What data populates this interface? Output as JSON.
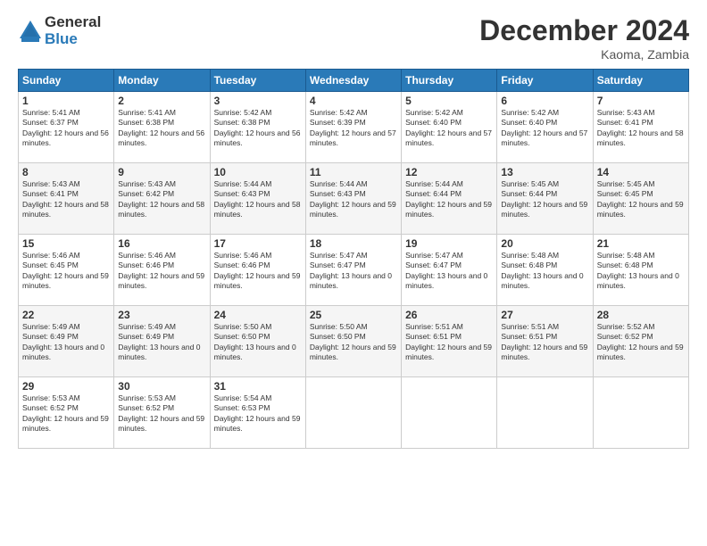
{
  "logo": {
    "general": "General",
    "blue": "Blue"
  },
  "title": "December 2024",
  "subtitle": "Kaoma, Zambia",
  "days": [
    "Sunday",
    "Monday",
    "Tuesday",
    "Wednesday",
    "Thursday",
    "Friday",
    "Saturday"
  ],
  "weeks": [
    [
      {
        "day": "1",
        "sunrise": "5:41 AM",
        "sunset": "6:37 PM",
        "daylight": "12 hours and 56 minutes."
      },
      {
        "day": "2",
        "sunrise": "5:41 AM",
        "sunset": "6:38 PM",
        "daylight": "12 hours and 56 minutes."
      },
      {
        "day": "3",
        "sunrise": "5:42 AM",
        "sunset": "6:38 PM",
        "daylight": "12 hours and 56 minutes."
      },
      {
        "day": "4",
        "sunrise": "5:42 AM",
        "sunset": "6:39 PM",
        "daylight": "12 hours and 57 minutes."
      },
      {
        "day": "5",
        "sunrise": "5:42 AM",
        "sunset": "6:40 PM",
        "daylight": "12 hours and 57 minutes."
      },
      {
        "day": "6",
        "sunrise": "5:42 AM",
        "sunset": "6:40 PM",
        "daylight": "12 hours and 57 minutes."
      },
      {
        "day": "7",
        "sunrise": "5:43 AM",
        "sunset": "6:41 PM",
        "daylight": "12 hours and 58 minutes."
      }
    ],
    [
      {
        "day": "8",
        "sunrise": "5:43 AM",
        "sunset": "6:41 PM",
        "daylight": "12 hours and 58 minutes."
      },
      {
        "day": "9",
        "sunrise": "5:43 AM",
        "sunset": "6:42 PM",
        "daylight": "12 hours and 58 minutes."
      },
      {
        "day": "10",
        "sunrise": "5:44 AM",
        "sunset": "6:43 PM",
        "daylight": "12 hours and 58 minutes."
      },
      {
        "day": "11",
        "sunrise": "5:44 AM",
        "sunset": "6:43 PM",
        "daylight": "12 hours and 59 minutes."
      },
      {
        "day": "12",
        "sunrise": "5:44 AM",
        "sunset": "6:44 PM",
        "daylight": "12 hours and 59 minutes."
      },
      {
        "day": "13",
        "sunrise": "5:45 AM",
        "sunset": "6:44 PM",
        "daylight": "12 hours and 59 minutes."
      },
      {
        "day": "14",
        "sunrise": "5:45 AM",
        "sunset": "6:45 PM",
        "daylight": "12 hours and 59 minutes."
      }
    ],
    [
      {
        "day": "15",
        "sunrise": "5:46 AM",
        "sunset": "6:45 PM",
        "daylight": "12 hours and 59 minutes."
      },
      {
        "day": "16",
        "sunrise": "5:46 AM",
        "sunset": "6:46 PM",
        "daylight": "12 hours and 59 minutes."
      },
      {
        "day": "17",
        "sunrise": "5:46 AM",
        "sunset": "6:46 PM",
        "daylight": "12 hours and 59 minutes."
      },
      {
        "day": "18",
        "sunrise": "5:47 AM",
        "sunset": "6:47 PM",
        "daylight": "13 hours and 0 minutes."
      },
      {
        "day": "19",
        "sunrise": "5:47 AM",
        "sunset": "6:47 PM",
        "daylight": "13 hours and 0 minutes."
      },
      {
        "day": "20",
        "sunrise": "5:48 AM",
        "sunset": "6:48 PM",
        "daylight": "13 hours and 0 minutes."
      },
      {
        "day": "21",
        "sunrise": "5:48 AM",
        "sunset": "6:48 PM",
        "daylight": "13 hours and 0 minutes."
      }
    ],
    [
      {
        "day": "22",
        "sunrise": "5:49 AM",
        "sunset": "6:49 PM",
        "daylight": "13 hours and 0 minutes."
      },
      {
        "day": "23",
        "sunrise": "5:49 AM",
        "sunset": "6:49 PM",
        "daylight": "13 hours and 0 minutes."
      },
      {
        "day": "24",
        "sunrise": "5:50 AM",
        "sunset": "6:50 PM",
        "daylight": "13 hours and 0 minutes."
      },
      {
        "day": "25",
        "sunrise": "5:50 AM",
        "sunset": "6:50 PM",
        "daylight": "12 hours and 59 minutes."
      },
      {
        "day": "26",
        "sunrise": "5:51 AM",
        "sunset": "6:51 PM",
        "daylight": "12 hours and 59 minutes."
      },
      {
        "day": "27",
        "sunrise": "5:51 AM",
        "sunset": "6:51 PM",
        "daylight": "12 hours and 59 minutes."
      },
      {
        "day": "28",
        "sunrise": "5:52 AM",
        "sunset": "6:52 PM",
        "daylight": "12 hours and 59 minutes."
      }
    ],
    [
      {
        "day": "29",
        "sunrise": "5:53 AM",
        "sunset": "6:52 PM",
        "daylight": "12 hours and 59 minutes."
      },
      {
        "day": "30",
        "sunrise": "5:53 AM",
        "sunset": "6:52 PM",
        "daylight": "12 hours and 59 minutes."
      },
      {
        "day": "31",
        "sunrise": "5:54 AM",
        "sunset": "6:53 PM",
        "daylight": "12 hours and 59 minutes."
      },
      null,
      null,
      null,
      null
    ]
  ]
}
